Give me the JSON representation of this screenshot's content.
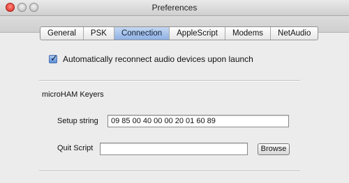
{
  "window": {
    "title": "Preferences"
  },
  "tabs": [
    {
      "label": "General",
      "selected": false
    },
    {
      "label": "PSK",
      "selected": false
    },
    {
      "label": "Connection",
      "selected": true
    },
    {
      "label": "AppleScript",
      "selected": false
    },
    {
      "label": "Modems",
      "selected": false
    },
    {
      "label": "NetAudio",
      "selected": false
    }
  ],
  "connection": {
    "auto_reconnect": {
      "label": "Automatically reconnect audio devices upon launch",
      "checked": true
    },
    "section_title": "microHAM Keyers",
    "setup_string": {
      "label": "Setup string",
      "value": "09 85 00 40 00 00 20 01 60 89"
    },
    "quit_script": {
      "label": "Quit Script",
      "value": ""
    },
    "browse_label": "Browse"
  },
  "icons": {
    "close": "close-icon",
    "minimize": "minimize-icon",
    "zoom": "zoom-icon",
    "check": "checkmark-icon"
  }
}
